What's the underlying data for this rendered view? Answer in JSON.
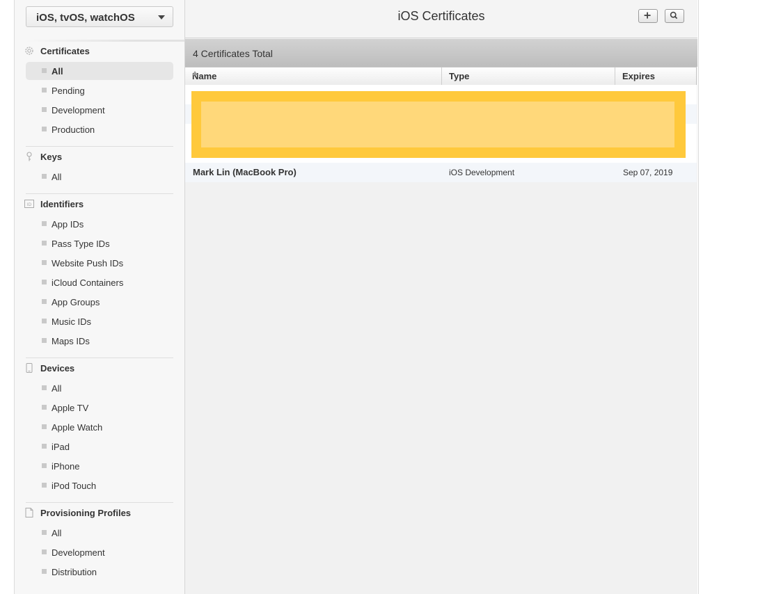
{
  "sidebar": {
    "platform_select": {
      "value": "iOS, tvOS, watchOS"
    },
    "sections": [
      {
        "title": "Certificates",
        "icon": "certificate-gear-icon",
        "items": [
          {
            "label": "All"
          },
          {
            "label": "Pending"
          },
          {
            "label": "Development"
          },
          {
            "label": "Production"
          }
        ]
      },
      {
        "title": "Keys",
        "icon": "key-icon",
        "items": [
          {
            "label": "All"
          }
        ]
      },
      {
        "title": "Identifiers",
        "icon": "id-icon",
        "items": [
          {
            "label": "App IDs"
          },
          {
            "label": "Pass Type IDs"
          },
          {
            "label": "Website Push IDs"
          },
          {
            "label": "iCloud Containers"
          },
          {
            "label": "App Groups"
          },
          {
            "label": "Music IDs"
          },
          {
            "label": "Maps IDs"
          }
        ]
      },
      {
        "title": "Devices",
        "icon": "device-icon",
        "items": [
          {
            "label": "All"
          },
          {
            "label": "Apple TV"
          },
          {
            "label": "Apple Watch"
          },
          {
            "label": "iPad"
          },
          {
            "label": "iPhone"
          },
          {
            "label": "iPod Touch"
          }
        ]
      },
      {
        "title": "Provisioning Profiles",
        "icon": "document-icon",
        "items": [
          {
            "label": "All"
          },
          {
            "label": "Development"
          },
          {
            "label": "Distribution"
          }
        ]
      }
    ],
    "active_item": "Certificates/All"
  },
  "main": {
    "title": "iOS Certificates",
    "toolbar": {
      "add_icon": "plus-icon",
      "search_icon": "search-icon"
    },
    "count_text": "4 Certificates Total",
    "columns": [
      "Name",
      "Type",
      "Expires"
    ],
    "sorted_column": "Name",
    "rows": [
      {
        "name": "Mark Lin (MacBook Pro)",
        "type": "iOS Development",
        "expires": "Sep 07, 2019"
      }
    ],
    "colors": {
      "redaction": "#ffc93c",
      "redaction_inner": "#ffd87a"
    }
  }
}
